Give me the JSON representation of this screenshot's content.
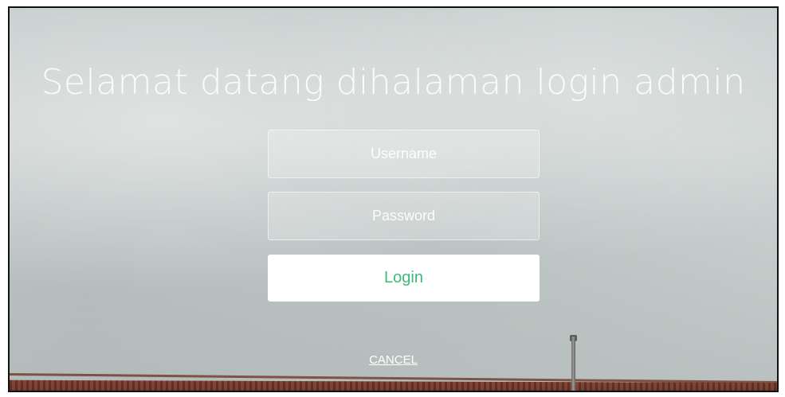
{
  "page": {
    "title": "Selamat datang dihalaman login admin"
  },
  "form": {
    "username_placeholder": "Username",
    "username_value": "",
    "password_placeholder": "Password",
    "password_value": "",
    "login_label": "Login",
    "cancel_label": "CANCEL"
  },
  "colors": {
    "login_text": "#3dbb78",
    "login_background": "#ffffff",
    "title_text": "#ffffff"
  }
}
